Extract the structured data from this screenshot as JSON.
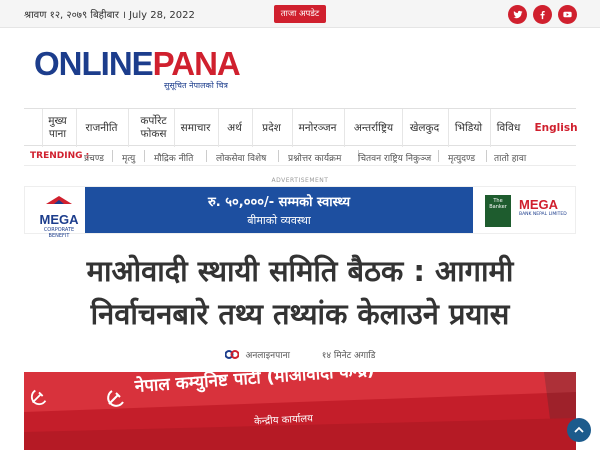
{
  "topbar": {
    "date": "श्रावण १२, २०७९ बिहीबार । July 28, 2022",
    "update_button": "ताजा अपडेट",
    "social": [
      {
        "name": "twitter-icon"
      },
      {
        "name": "facebook-icon"
      },
      {
        "name": "youtube-icon"
      }
    ]
  },
  "logo": {
    "word_blue": "ONLINE",
    "word_red": "PANA",
    "tagline": "सुसूचित नेपालको चित्र"
  },
  "nav": {
    "items": [
      "मुख्य पाना",
      "राजनीति",
      "कर्पोरेट फोकस",
      "समाचार",
      "अर्थ",
      "प्रदेश",
      "मनोरञ्जन",
      "अन्तर्राष्ट्रिय",
      "खेलकुद",
      "भिडियो",
      "विविध"
    ],
    "language": "English"
  },
  "trending": {
    "label": "TRENDING :",
    "items": [
      "प्रचण्ड",
      "मृत्यु",
      "मौद्रिक नीति",
      "लोकसेवा विशेष",
      "प्रश्नोत्तर कार्यक्रम",
      "चितवन राष्ट्रिय निकुञ्ज",
      "मृत्युदण्ड",
      "तातो हावा"
    ]
  },
  "ad": {
    "label": "ADVERTISEMENT",
    "left_brand": "MEGA",
    "left_sub": "CORPORATE BENEFIT",
    "line1": "रु. ५०,०००/- सम्मको स्वास्थ्य",
    "line2": "बीमाको व्यवस्था",
    "book_text": "The Banker",
    "right_brand": "MEGA",
    "right_sub": "BANK NEPAL LIMITED"
  },
  "article": {
    "headline_line1": "माओवादी स्थायी समिति बैठक : आगामी",
    "headline_line2": "निर्वाचनबारे तथ्य तथ्यांक केलाउने प्रयास",
    "author": "अनलाइनपाना",
    "time": "१४ मिनेट अगाडि"
  },
  "hero": {
    "banner_text": "नेपाल कम्युनिष्ट पार्टी (माओवादी केन्द्र)",
    "office_text": "केन्द्रीय कार्यालय"
  },
  "colors": {
    "brand_red": "#d0202e",
    "brand_blue": "#1c3d8c",
    "ad_blue": "#1d4fa0",
    "scrolltop": "#1c5b8c"
  }
}
